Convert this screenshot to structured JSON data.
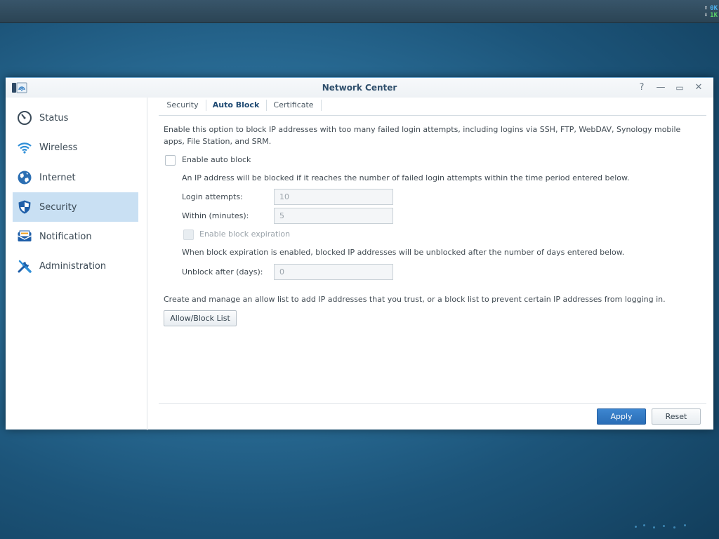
{
  "taskbar": {
    "upload": "0K",
    "download": "1K"
  },
  "window": {
    "title": "Network Center",
    "help_glyph": "?",
    "minimize_glyph": "—",
    "maximize_glyph": "▭",
    "close_glyph": "✕"
  },
  "sidebar": {
    "items": [
      {
        "label": "Status",
        "icon": "gauge-icon"
      },
      {
        "label": "Wireless",
        "icon": "wifi-icon"
      },
      {
        "label": "Internet",
        "icon": "globe-icon"
      },
      {
        "label": "Security",
        "icon": "shield-icon",
        "active": true
      },
      {
        "label": "Notification",
        "icon": "envelope-icon"
      },
      {
        "label": "Administration",
        "icon": "tools-icon"
      }
    ]
  },
  "tabs": [
    {
      "label": "Security"
    },
    {
      "label": "Auto Block",
      "active": true
    },
    {
      "label": "Certificate"
    }
  ],
  "autoblock": {
    "intro": "Enable this option to block IP addresses with too many failed login attempts, including logins via SSH, FTP, WebDAV, Synology mobile apps, File Station, and SRM.",
    "enable_label": "Enable auto block",
    "enable_checked": false,
    "rule_text": "An IP address will be blocked if it reaches the number of failed login attempts within the time period entered below.",
    "login_attempts_label": "Login attempts:",
    "login_attempts_value": "10",
    "within_label": "Within (minutes):",
    "within_value": "5",
    "expiration_label": "Enable block expiration",
    "expiration_checked": false,
    "expiration_text": "When block expiration is enabled, blocked IP addresses will be unblocked after the number of days entered below.",
    "unblock_label": "Unblock after (days):",
    "unblock_value": "0",
    "list_text": "Create and manage an allow list to add IP addresses that you trust, or a block list to prevent certain IP addresses from logging in.",
    "list_button": "Allow/Block List"
  },
  "footer": {
    "apply": "Apply",
    "reset": "Reset"
  },
  "colors": {
    "accent": "#2a6db6",
    "active_nav": "#c9e0f3"
  }
}
